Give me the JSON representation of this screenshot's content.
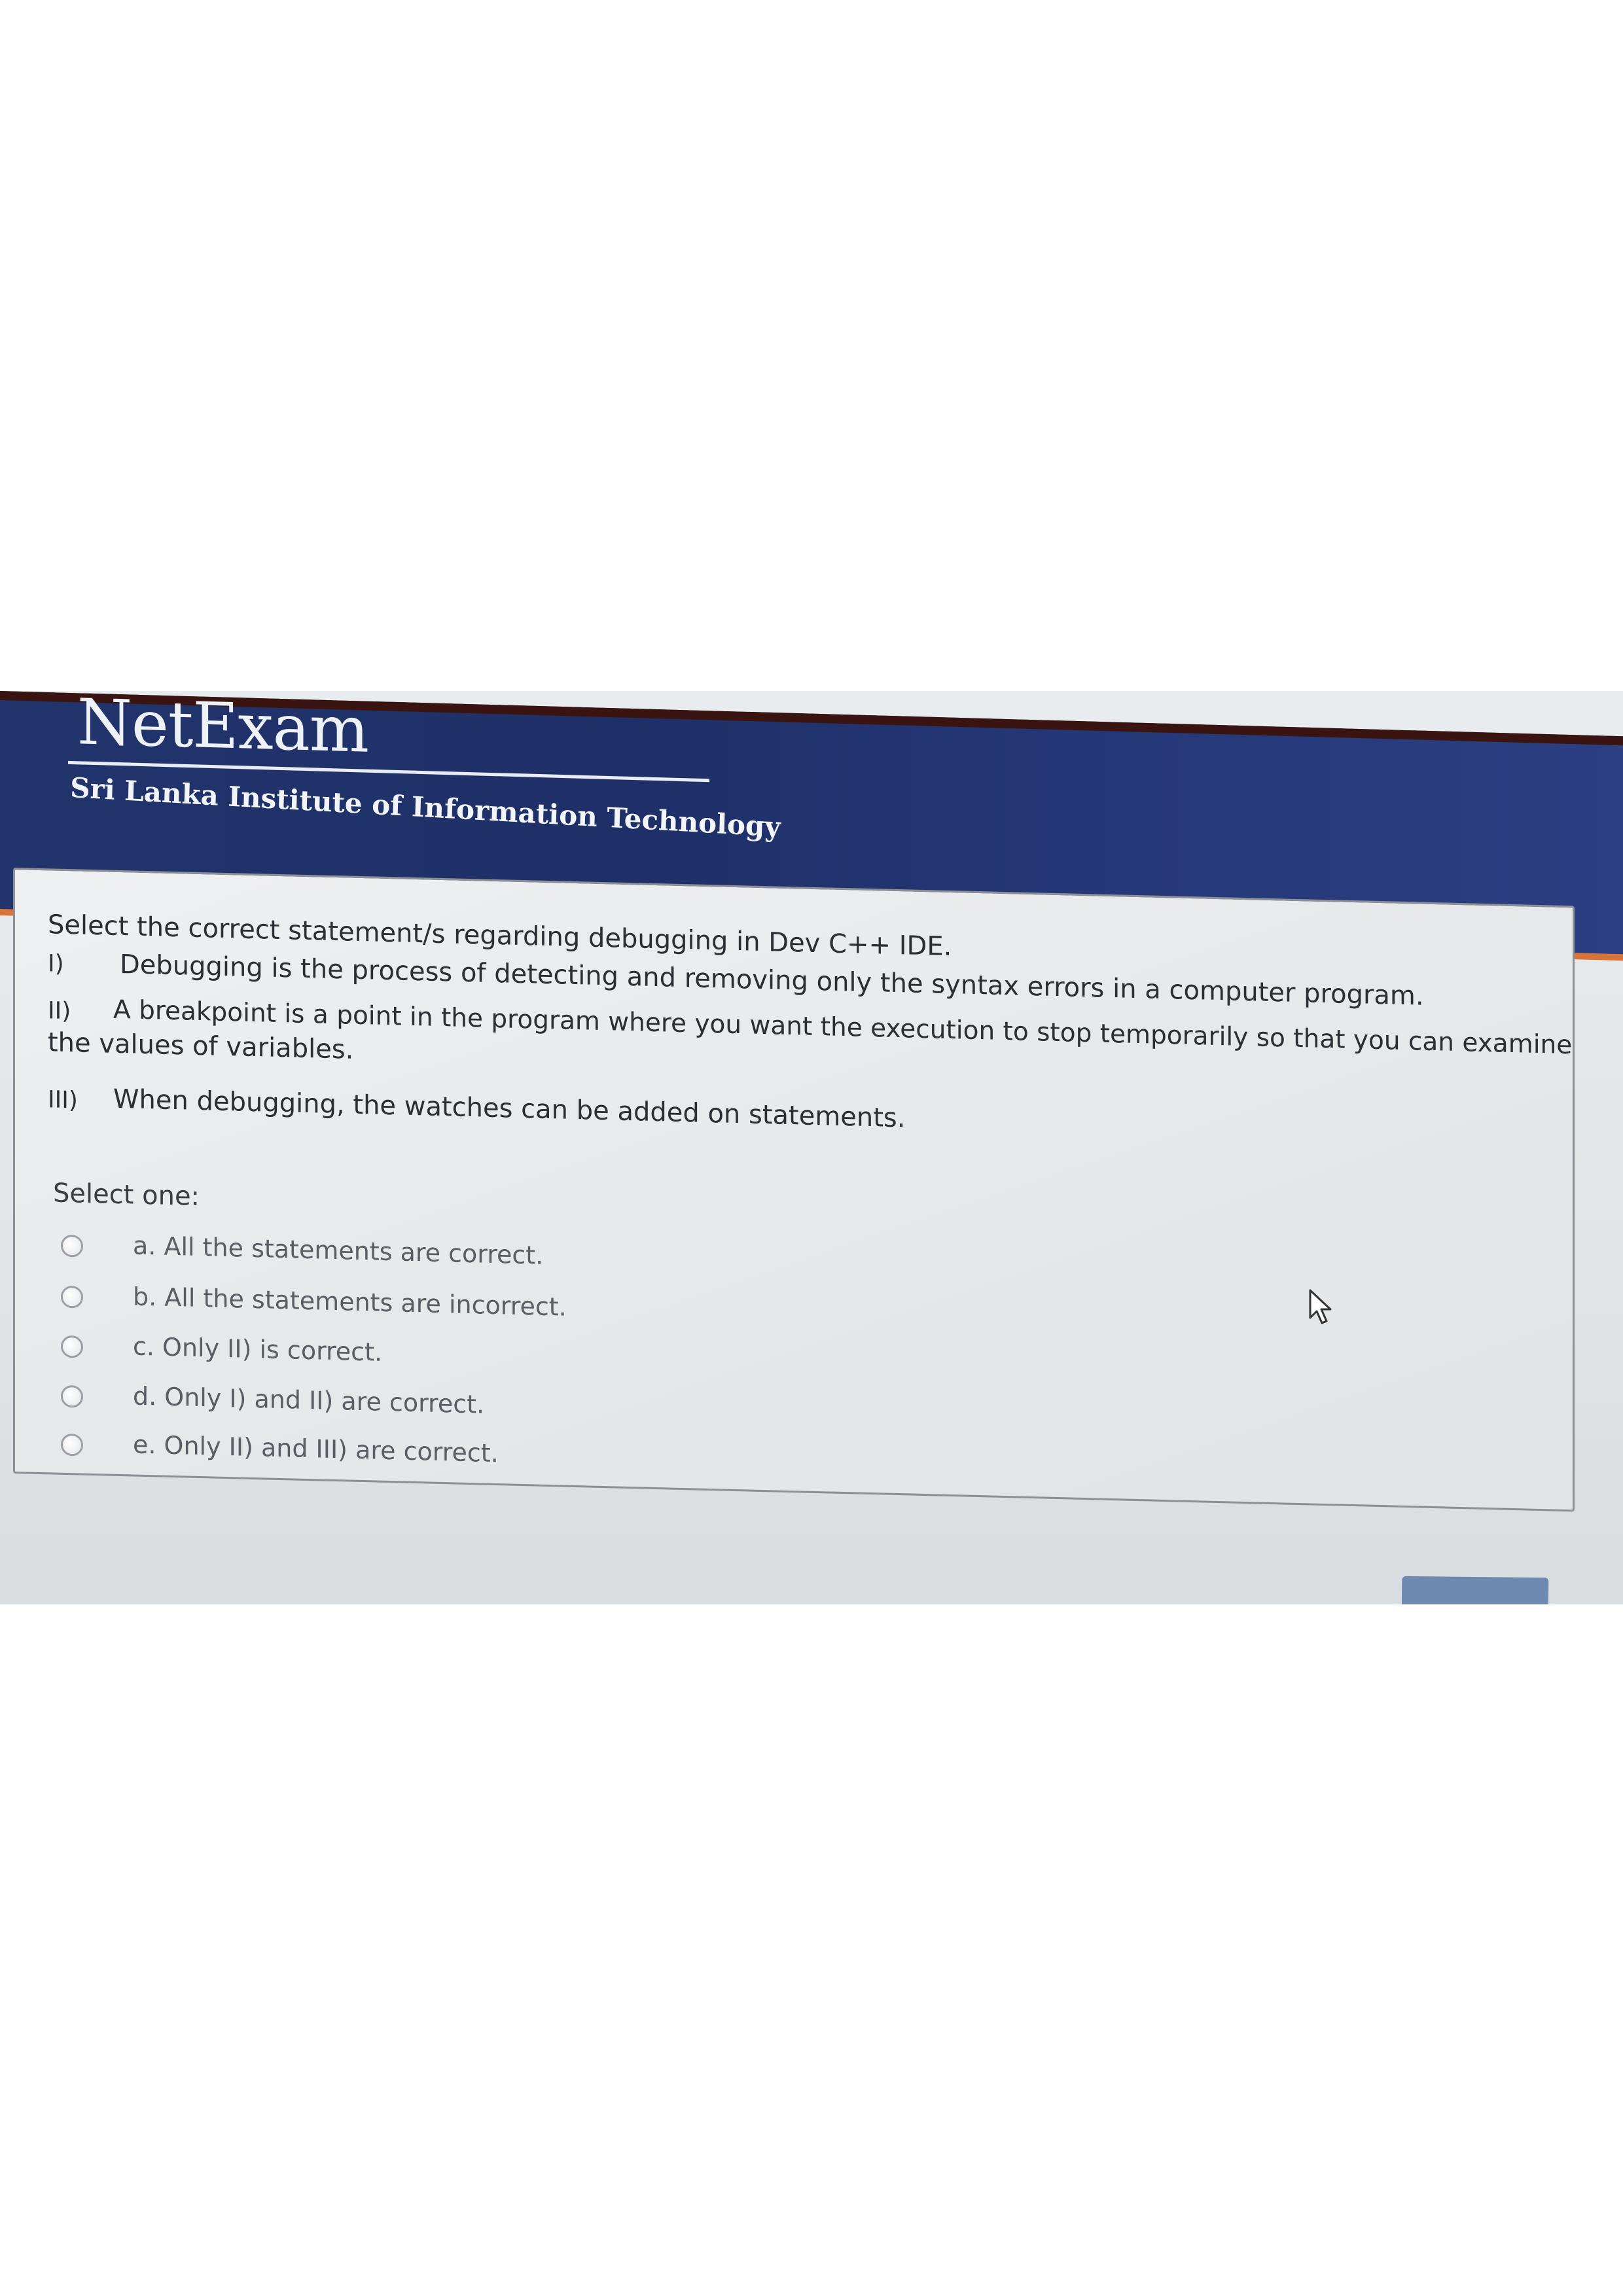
{
  "header": {
    "logo": "NetExam",
    "institute": "Sri Lanka Institute of Information Technology"
  },
  "question": {
    "prompt": "Select the correct statement/s regarding debugging in Dev C++ IDE.",
    "statements": [
      {
        "num": "I)",
        "text": "Debugging is the process of detecting and removing only the syntax errors  in a computer program."
      },
      {
        "num": "II)",
        "text": "A breakpoint is a point in the program where you want the execution to stop temporarily so that you can examine",
        "text_cont": "the values of variables."
      },
      {
        "num": "III)",
        "text": "When debugging, the watches can be added on statements."
      }
    ],
    "select_one": "Select one:",
    "options": [
      {
        "label": "a. All the statements are correct."
      },
      {
        "label": "b. All the statements are incorrect."
      },
      {
        "label": "c. Only II) is  correct."
      },
      {
        "label": "d. Only I) and II) are correct."
      },
      {
        "label": "e. Only II) and III) are correct."
      }
    ]
  },
  "icons": {
    "radio": "radio-unchecked-icon",
    "cursor": "mouse-pointer-icon"
  },
  "colors": {
    "header": "#22346c",
    "header_accent": "#d8743a",
    "card_border": "#8c9096",
    "button": "#6f8ab0"
  }
}
